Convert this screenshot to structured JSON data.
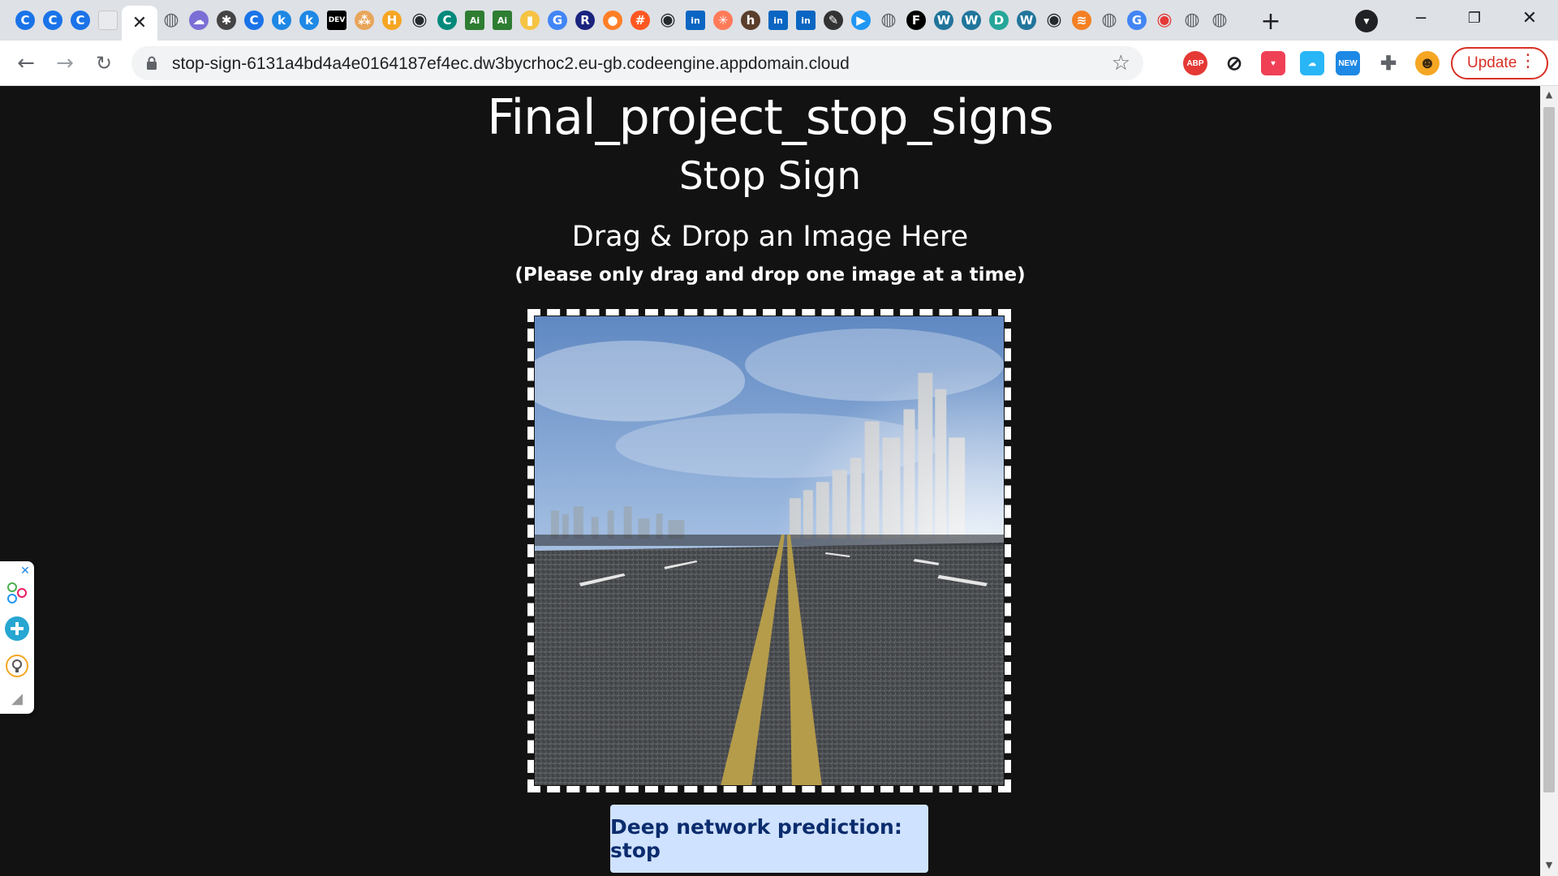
{
  "browser": {
    "tabs": [
      {
        "icon": "google-c-icon",
        "glyph": "C",
        "color": "#1a73e8"
      },
      {
        "icon": "google-c-icon",
        "glyph": "C",
        "color": "#1a73e8"
      },
      {
        "icon": "google-c-icon",
        "glyph": "C",
        "color": "#1a73e8"
      },
      {
        "icon": "blank-doc-icon",
        "glyph": "",
        "color": "#c7c7c7"
      },
      {
        "icon": "close-icon",
        "glyph": "✕",
        "color": "#202124",
        "active": true
      },
      {
        "icon": "globe-icon",
        "glyph": "◍",
        "color": "#5f6368"
      },
      {
        "icon": "cloud-icon",
        "glyph": "☁",
        "color": "#7b6fd6"
      },
      {
        "icon": "wasp-icon",
        "glyph": "✱",
        "color": "#444444"
      },
      {
        "icon": "google-c-icon",
        "glyph": "C",
        "color": "#1a73e8"
      },
      {
        "icon": "k-icon",
        "glyph": "k",
        "color": "#1e88e5"
      },
      {
        "icon": "k-icon",
        "glyph": "k",
        "color": "#1e88e5"
      },
      {
        "icon": "dev-icon",
        "glyph": "DEV",
        "color": "#000000"
      },
      {
        "icon": "dots-icon",
        "glyph": "⁂",
        "color": "#e8a55a"
      },
      {
        "icon": "h-icon",
        "glyph": "H",
        "color": "#f5a623"
      },
      {
        "icon": "github-icon",
        "glyph": "◉",
        "color": "#24292e"
      },
      {
        "icon": "c-icon",
        "glyph": "C",
        "color": "#00897b"
      },
      {
        "icon": "ai-icon",
        "glyph": "Ai",
        "color": "#2e7d32"
      },
      {
        "icon": "ai-icon",
        "glyph": "Ai",
        "color": "#2e7d32"
      },
      {
        "icon": "bar-chart-icon",
        "glyph": "▮",
        "color": "#f6c343"
      },
      {
        "icon": "google-icon",
        "glyph": "G",
        "color": "#4285f4"
      },
      {
        "icon": "r-icon",
        "glyph": "R",
        "color": "#1a237e"
      },
      {
        "icon": "orange-dot-icon",
        "glyph": "●",
        "color": "#ff7f27"
      },
      {
        "icon": "grid-icon",
        "glyph": "#",
        "color": "#ff5722"
      },
      {
        "icon": "github-icon",
        "glyph": "◉",
        "color": "#24292e"
      },
      {
        "icon": "linkedin-icon",
        "glyph": "in",
        "color": "#0a66c2"
      },
      {
        "icon": "hubspot-icon",
        "glyph": "✳",
        "color": "#ff7a59"
      },
      {
        "icon": "h-icon",
        "glyph": "h",
        "color": "#5a3e2b"
      },
      {
        "icon": "linkedin-icon",
        "glyph": "in",
        "color": "#0a66c2"
      },
      {
        "icon": "linkedin-icon",
        "glyph": "in",
        "color": "#0a66c2"
      },
      {
        "icon": "pen-icon",
        "glyph": "✎",
        "color": "#333333"
      },
      {
        "icon": "video-icon",
        "glyph": "▶",
        "color": "#2196f3"
      },
      {
        "icon": "globe-icon",
        "glyph": "◍",
        "color": "#5f6368"
      },
      {
        "icon": "f-icon",
        "glyph": "F",
        "color": "#000000"
      },
      {
        "icon": "wordpress-icon",
        "glyph": "W",
        "color": "#21759b"
      },
      {
        "icon": "wordpress-icon",
        "glyph": "W",
        "color": "#21759b"
      },
      {
        "icon": "d-icon",
        "glyph": "D",
        "color": "#26a69a"
      },
      {
        "icon": "wordpress-icon",
        "glyph": "W",
        "color": "#21759b"
      },
      {
        "icon": "github-icon",
        "glyph": "◉",
        "color": "#24292e"
      },
      {
        "icon": "stack-icon",
        "glyph": "≋",
        "color": "#f48024"
      },
      {
        "icon": "globe-icon",
        "glyph": "◍",
        "color": "#5f6368"
      },
      {
        "icon": "google-icon",
        "glyph": "G",
        "color": "#4285f4"
      },
      {
        "icon": "chat-icon",
        "glyph": "◉",
        "color": "#e53935"
      },
      {
        "icon": "globe-icon",
        "glyph": "◍",
        "color": "#5f6368"
      },
      {
        "icon": "globe-icon",
        "glyph": "◍",
        "color": "#5f6368"
      }
    ],
    "url": "stop-sign-6131a4bd4a4e0164187ef4ec.dw3bycrhoc2.eu-gb.codeengine.appdomain.cloud",
    "update_label": "Update",
    "extensions": [
      {
        "name": "adblock-icon",
        "glyph": "ABP",
        "color": "#e53935"
      },
      {
        "name": "no-script-icon",
        "glyph": "⊘",
        "color": "#202124"
      },
      {
        "name": "pocket-icon",
        "glyph": "♥",
        "color": "#ef4056"
      },
      {
        "name": "cloud-sync-icon",
        "glyph": "☁",
        "color": "#29b6f6"
      },
      {
        "name": "new-badge-icon",
        "glyph": "NEW",
        "color": "#1e88e5"
      },
      {
        "name": "puzzle-icon",
        "glyph": "✚",
        "color": "#5f6368"
      },
      {
        "name": "profile-avatar-icon",
        "glyph": "☻",
        "color": "#f5a623"
      }
    ]
  },
  "page": {
    "title": "Final_project_stop_signs",
    "subtitle": "Stop Sign",
    "drop_heading": "Drag & Drop an Image Here",
    "drop_note": "(Please only drag and drop one image at a time)",
    "prediction": "Deep network prediction: stop"
  },
  "colors": {
    "page_background": "#121212",
    "prediction_background": "#cfe2ff",
    "prediction_text": "#0b2c6d",
    "update_accent": "#d93025"
  }
}
